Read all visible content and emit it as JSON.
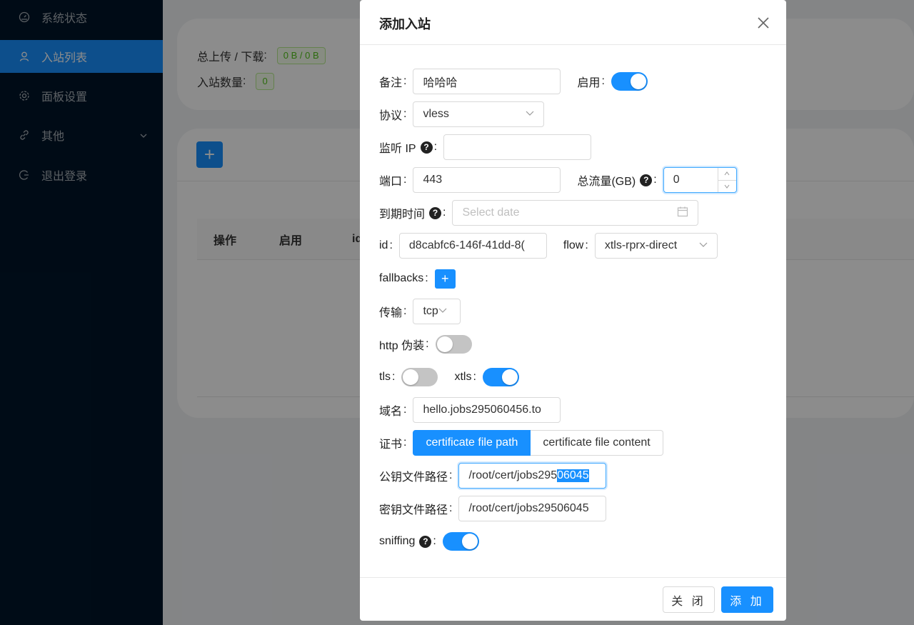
{
  "sidebar": {
    "items": [
      {
        "label": "系统状态",
        "icon": "dashboard-icon"
      },
      {
        "label": "入站列表",
        "icon": "user-icon",
        "active": true
      },
      {
        "label": "面板设置",
        "icon": "gear-icon"
      },
      {
        "label": "其他",
        "icon": "link-icon",
        "has_submenu": true
      },
      {
        "label": "退出登录",
        "icon": "logout-icon"
      }
    ]
  },
  "background": {
    "stats": {
      "upload_download_label": "总上传 / 下载",
      "upload_download_value": "0 B / 0 B",
      "inbound_count_label": "入站数量",
      "inbound_count_value": "0"
    },
    "table_headers": [
      "操作",
      "启用",
      "id"
    ]
  },
  "modal": {
    "title": "添加入站",
    "fields": {
      "remark": {
        "label": "备注",
        "value": "哈哈哈"
      },
      "enable": {
        "label": "启用",
        "on": true
      },
      "protocol": {
        "label": "协议",
        "value": "vless"
      },
      "listen_ip": {
        "label": "监听 IP",
        "value": ""
      },
      "port": {
        "label": "端口",
        "value": "443"
      },
      "total_traffic": {
        "label": "总流量(GB)",
        "value": "0"
      },
      "expiry": {
        "label": "到期时间",
        "placeholder": "Select date"
      },
      "id": {
        "label": "id",
        "value": "d8cabfc6-146f-41dd-8("
      },
      "flow": {
        "label": "flow",
        "value": "xtls-rprx-direct"
      },
      "fallbacks": {
        "label": "fallbacks"
      },
      "transport": {
        "label": "传输",
        "value": "tcp"
      },
      "http_camouflage": {
        "label": "http 伪装",
        "on": false
      },
      "tls": {
        "label": "tls",
        "on": false
      },
      "xtls": {
        "label": "xtls",
        "on": true
      },
      "domain": {
        "label": "域名",
        "value": "hello.jobs295060456.to"
      },
      "certificate": {
        "label": "证书",
        "options": [
          "certificate file path",
          "certificate file content"
        ],
        "selected": "certificate file path"
      },
      "public_key_path": {
        "label": "公钥文件路径",
        "value_plain": "/root/cert/jobs295",
        "value_selected": "06045"
      },
      "private_key_path": {
        "label": "密钥文件路径",
        "value": "/root/cert/jobs29506045"
      },
      "sniffing": {
        "label": "sniffing",
        "on": true
      }
    },
    "footer": {
      "close_label": "关 闭",
      "add_label": "添 加"
    }
  },
  "colors": {
    "primary": "#1890ff",
    "sidebar_bg": "#001529",
    "success": "#52c41a"
  }
}
